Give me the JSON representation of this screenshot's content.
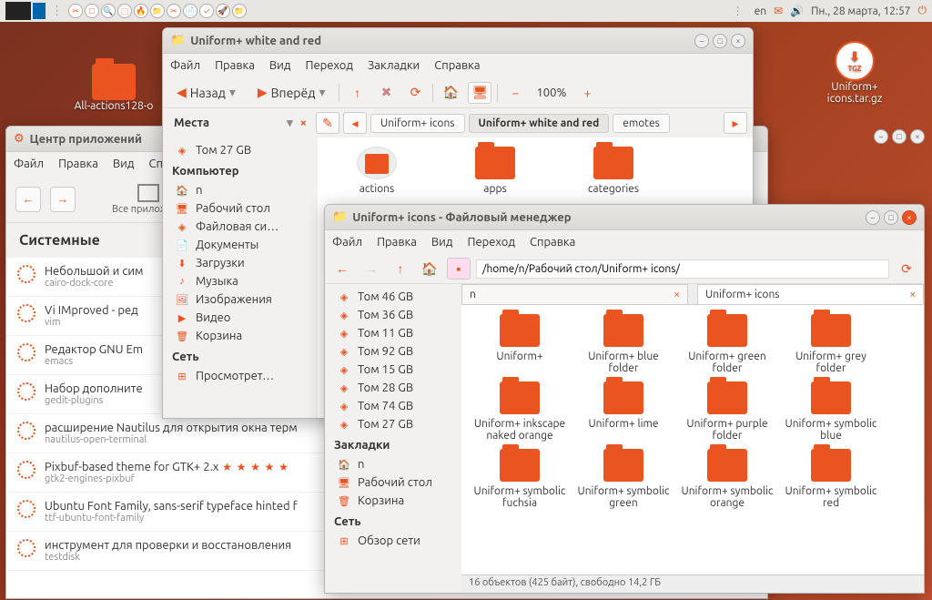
{
  "panel": {
    "lang": "en",
    "clock": "Пн., 28 марта, 12:57"
  },
  "desktop": {
    "icon1": "All-actions128-o",
    "icon2": "Uniform+ icons.tar.gz",
    "tgz": "TGZ"
  },
  "win1": {
    "title": "Uniform+ white and red",
    "menu": {
      "file": "Файл",
      "edit": "Правка",
      "view": "Вид",
      "go": "Переход",
      "bookmarks": "Закладки",
      "help": "Справка"
    },
    "back": "Назад",
    "forward": "Вперёд",
    "zoom": "100%",
    "places_hdr": "Места",
    "side": {
      "vol27": "Том 27 GB",
      "computer": "Компьютер",
      "home": "n",
      "desktop": "Рабочий стол",
      "filesystem": "Файловая си…",
      "documents": "Документы",
      "downloads": "Загрузки",
      "music": "Музыка",
      "pictures": "Изображения",
      "video": "Видео",
      "trash": "Корзина",
      "network_hdr": "Сеть",
      "browse": "Просмотрет…"
    },
    "crumbs": {
      "a": "Uniform+ icons",
      "b": "Uniform+ white and red",
      "c": "emotes"
    },
    "grid": {
      "actions": "actions",
      "apps": "apps",
      "categories": "categories"
    }
  },
  "win2": {
    "title": "Uniform+ icons - Файловый менеджер",
    "menu": {
      "file": "Файл",
      "edit": "Правка",
      "view": "Вид",
      "go": "Переход",
      "help": "Справка"
    },
    "path": "/home/n/Рабочий стол/Uniform+ icons/",
    "side": {
      "v46": "Том 46 GB",
      "v36": "Том 36 GB",
      "v11": "Том 11 GB",
      "v92": "Том 92 GB",
      "v15": "Том 15 GB",
      "v28": "Том 28 GB",
      "v74": "Том 74 GB",
      "v27": "Том 27 GB",
      "bookmarks": "Закладки",
      "home": "n",
      "desktop": "Рабочий стол",
      "trash": "Корзина",
      "network_hdr": "Сеть",
      "browse": "Обзор сети"
    },
    "tabs": {
      "a": "n",
      "b": "Uniform+ icons"
    },
    "folders": {
      "f1": "Uniform+",
      "f2": "Uniform+ blue folder",
      "f3": "Uniform+ green folder",
      "f4": "Uniform+ grey folder",
      "f5": "Uniform+ inkscape naked orange",
      "f6": "Uniform+ lime",
      "f7": "Uniform+ purple folder",
      "f8": "Uniform+ symbolic blue",
      "f9": "Uniform+ symbolic fuchsia",
      "f10": "Uniform+ symbolic green",
      "f11": "Uniform+ symbolic orange",
      "f12": "Uniform+ symbolic red"
    },
    "status": "16 объектов (425 байт), свободно 14,2 ГБ"
  },
  "appcenter": {
    "title": "Центр приложений",
    "menu": {
      "file": "Файл",
      "edit": "Правка",
      "view": "Вид",
      "help": "Спр"
    },
    "allapps": "Все приложени",
    "section": "Системные",
    "apps": [
      {
        "n": "Небольшой и сим",
        "p": "cairo-dock-core"
      },
      {
        "n": "Vi IMproved - ред",
        "p": "vim"
      },
      {
        "n": "Редактор GNU Em",
        "p": "emacs"
      },
      {
        "n": "Набор дополните",
        "p": "gedit-plugins"
      },
      {
        "n": "расширение Nautilus для открытия окна терм",
        "p": "nautilus-open-terminal"
      },
      {
        "n": "Pixbuf-based theme for GTK+ 2.x",
        "p": "gtk2-engines-pixbuf",
        "stars": "★ ★ ★ ★ ★"
      },
      {
        "n": "Ubuntu Font Family, sans-serif typeface hinted f",
        "p": "ttf-ubuntu-font-family"
      },
      {
        "n": "инструмент для проверки и восстановления",
        "p": "testdisk"
      }
    ]
  }
}
